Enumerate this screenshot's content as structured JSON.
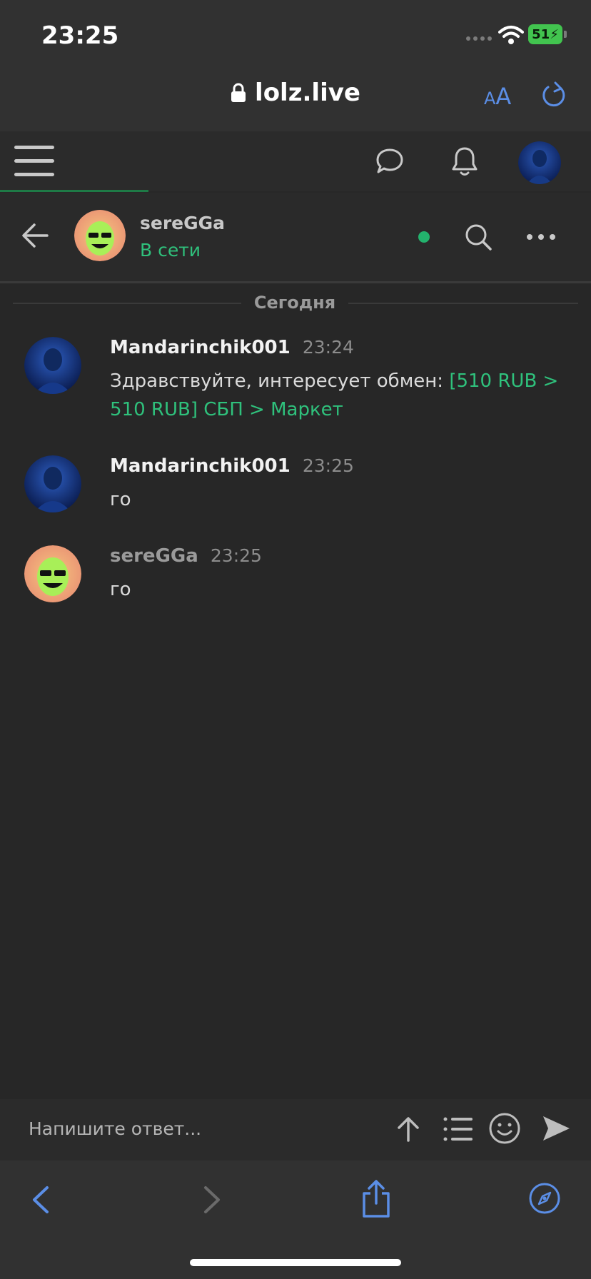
{
  "status_bar": {
    "time": "23:25",
    "battery": "51"
  },
  "browser": {
    "domain": "lolz.live",
    "text_size_label_small": "A",
    "text_size_label_large": "A"
  },
  "conversation": {
    "partner_name": "sereGGa",
    "partner_status": "В сети",
    "date_separator": "Сегодня"
  },
  "messages": [
    {
      "author": "Mandarinchik001",
      "time": "23:24",
      "text": "Здравствуйте, интересует обмен: ",
      "link_text": "[510 RUB > 510 RUB] СБП > Маркет"
    },
    {
      "author": "Mandarinchik001",
      "time": "23:25",
      "text": "го"
    },
    {
      "author": "sereGGa",
      "time": "23:25",
      "text": "го"
    }
  ],
  "composer": {
    "placeholder": "Напишите ответ..."
  },
  "colors": {
    "accent_green": "#2fc17c",
    "safari_blue": "#5b8ee6",
    "background": "#272727"
  },
  "icons": [
    "lock-icon",
    "reload-icon",
    "menu-icon",
    "chat-icon",
    "bell-icon",
    "back-arrow-icon",
    "search-icon",
    "more-icon",
    "upload-icon",
    "list-icon",
    "smile-icon",
    "send-icon",
    "safari-back-icon",
    "safari-forward-icon",
    "share-icon",
    "compass-icon"
  ]
}
